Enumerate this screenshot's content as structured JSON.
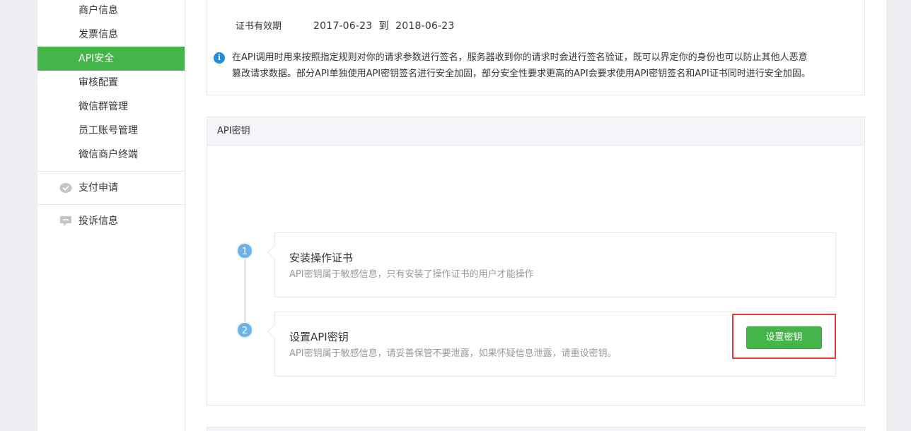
{
  "sidebar": {
    "items": [
      {
        "label": "商户信息"
      },
      {
        "label": "发票信息"
      },
      {
        "label": "API安全"
      },
      {
        "label": "审核配置"
      },
      {
        "label": "微信群管理"
      },
      {
        "label": "员工账号管理"
      },
      {
        "label": "微信商户终端"
      }
    ],
    "groups": [
      {
        "label": "支付申请",
        "icon": "payment-apply-icon"
      },
      {
        "label": "投诉信息",
        "icon": "complaint-icon"
      }
    ]
  },
  "cert": {
    "label": "证书有效期",
    "value": "2017-06-23  到  2018-06-23"
  },
  "api_key": {
    "title": "API密钥",
    "info": "在API调用时用来按照指定规则对你的请求参数进行签名，服务器收到你的请求时会进行签名验证，既可以界定你的身份也可以防止其他人恶意篡改请求数据。部分API单独使用API密钥签名进行安全加固，部分安全性要求更高的API会要求使用API密钥签名和API证书同时进行安全加固。",
    "steps": [
      {
        "num": "1",
        "title": "安装操作证书",
        "desc": "API密钥属于敏感信息，只有安装了操作证书的用户才能操作"
      },
      {
        "num": "2",
        "title": "设置API密钥",
        "desc": "API密钥属于敏感信息，请妥善保管不要泄露，如果怀疑信息泄露，请重设密钥。"
      }
    ],
    "button": "设置密钥"
  },
  "colors": {
    "accent": "#44b549",
    "info": "#1f8de2",
    "step": "#6cb2e8",
    "highlight": "#e53935"
  }
}
